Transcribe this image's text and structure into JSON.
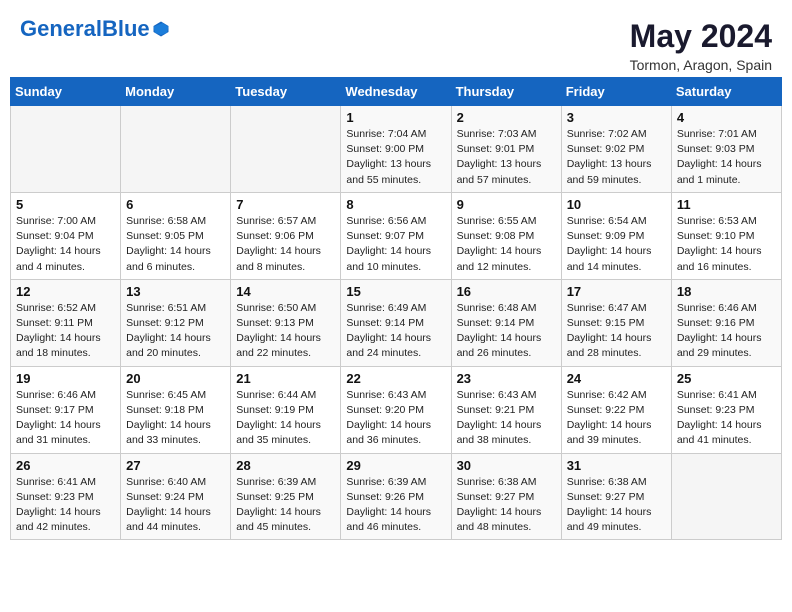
{
  "header": {
    "logo_general": "General",
    "logo_blue": "Blue",
    "title": "May 2024",
    "subtitle": "Tormon, Aragon, Spain"
  },
  "days_of_week": [
    "Sunday",
    "Monday",
    "Tuesday",
    "Wednesday",
    "Thursday",
    "Friday",
    "Saturday"
  ],
  "weeks": [
    [
      {
        "day": "",
        "info": ""
      },
      {
        "day": "",
        "info": ""
      },
      {
        "day": "",
        "info": ""
      },
      {
        "day": "1",
        "info": "Sunrise: 7:04 AM\nSunset: 9:00 PM\nDaylight: 13 hours\nand 55 minutes."
      },
      {
        "day": "2",
        "info": "Sunrise: 7:03 AM\nSunset: 9:01 PM\nDaylight: 13 hours\nand 57 minutes."
      },
      {
        "day": "3",
        "info": "Sunrise: 7:02 AM\nSunset: 9:02 PM\nDaylight: 13 hours\nand 59 minutes."
      },
      {
        "day": "4",
        "info": "Sunrise: 7:01 AM\nSunset: 9:03 PM\nDaylight: 14 hours\nand 1 minute."
      }
    ],
    [
      {
        "day": "5",
        "info": "Sunrise: 7:00 AM\nSunset: 9:04 PM\nDaylight: 14 hours\nand 4 minutes."
      },
      {
        "day": "6",
        "info": "Sunrise: 6:58 AM\nSunset: 9:05 PM\nDaylight: 14 hours\nand 6 minutes."
      },
      {
        "day": "7",
        "info": "Sunrise: 6:57 AM\nSunset: 9:06 PM\nDaylight: 14 hours\nand 8 minutes."
      },
      {
        "day": "8",
        "info": "Sunrise: 6:56 AM\nSunset: 9:07 PM\nDaylight: 14 hours\nand 10 minutes."
      },
      {
        "day": "9",
        "info": "Sunrise: 6:55 AM\nSunset: 9:08 PM\nDaylight: 14 hours\nand 12 minutes."
      },
      {
        "day": "10",
        "info": "Sunrise: 6:54 AM\nSunset: 9:09 PM\nDaylight: 14 hours\nand 14 minutes."
      },
      {
        "day": "11",
        "info": "Sunrise: 6:53 AM\nSunset: 9:10 PM\nDaylight: 14 hours\nand 16 minutes."
      }
    ],
    [
      {
        "day": "12",
        "info": "Sunrise: 6:52 AM\nSunset: 9:11 PM\nDaylight: 14 hours\nand 18 minutes."
      },
      {
        "day": "13",
        "info": "Sunrise: 6:51 AM\nSunset: 9:12 PM\nDaylight: 14 hours\nand 20 minutes."
      },
      {
        "day": "14",
        "info": "Sunrise: 6:50 AM\nSunset: 9:13 PM\nDaylight: 14 hours\nand 22 minutes."
      },
      {
        "day": "15",
        "info": "Sunrise: 6:49 AM\nSunset: 9:14 PM\nDaylight: 14 hours\nand 24 minutes."
      },
      {
        "day": "16",
        "info": "Sunrise: 6:48 AM\nSunset: 9:14 PM\nDaylight: 14 hours\nand 26 minutes."
      },
      {
        "day": "17",
        "info": "Sunrise: 6:47 AM\nSunset: 9:15 PM\nDaylight: 14 hours\nand 28 minutes."
      },
      {
        "day": "18",
        "info": "Sunrise: 6:46 AM\nSunset: 9:16 PM\nDaylight: 14 hours\nand 29 minutes."
      }
    ],
    [
      {
        "day": "19",
        "info": "Sunrise: 6:46 AM\nSunset: 9:17 PM\nDaylight: 14 hours\nand 31 minutes."
      },
      {
        "day": "20",
        "info": "Sunrise: 6:45 AM\nSunset: 9:18 PM\nDaylight: 14 hours\nand 33 minutes."
      },
      {
        "day": "21",
        "info": "Sunrise: 6:44 AM\nSunset: 9:19 PM\nDaylight: 14 hours\nand 35 minutes."
      },
      {
        "day": "22",
        "info": "Sunrise: 6:43 AM\nSunset: 9:20 PM\nDaylight: 14 hours\nand 36 minutes."
      },
      {
        "day": "23",
        "info": "Sunrise: 6:43 AM\nSunset: 9:21 PM\nDaylight: 14 hours\nand 38 minutes."
      },
      {
        "day": "24",
        "info": "Sunrise: 6:42 AM\nSunset: 9:22 PM\nDaylight: 14 hours\nand 39 minutes."
      },
      {
        "day": "25",
        "info": "Sunrise: 6:41 AM\nSunset: 9:23 PM\nDaylight: 14 hours\nand 41 minutes."
      }
    ],
    [
      {
        "day": "26",
        "info": "Sunrise: 6:41 AM\nSunset: 9:23 PM\nDaylight: 14 hours\nand 42 minutes."
      },
      {
        "day": "27",
        "info": "Sunrise: 6:40 AM\nSunset: 9:24 PM\nDaylight: 14 hours\nand 44 minutes."
      },
      {
        "day": "28",
        "info": "Sunrise: 6:39 AM\nSunset: 9:25 PM\nDaylight: 14 hours\nand 45 minutes."
      },
      {
        "day": "29",
        "info": "Sunrise: 6:39 AM\nSunset: 9:26 PM\nDaylight: 14 hours\nand 46 minutes."
      },
      {
        "day": "30",
        "info": "Sunrise: 6:38 AM\nSunset: 9:27 PM\nDaylight: 14 hours\nand 48 minutes."
      },
      {
        "day": "31",
        "info": "Sunrise: 6:38 AM\nSunset: 9:27 PM\nDaylight: 14 hours\nand 49 minutes."
      },
      {
        "day": "",
        "info": ""
      }
    ]
  ]
}
